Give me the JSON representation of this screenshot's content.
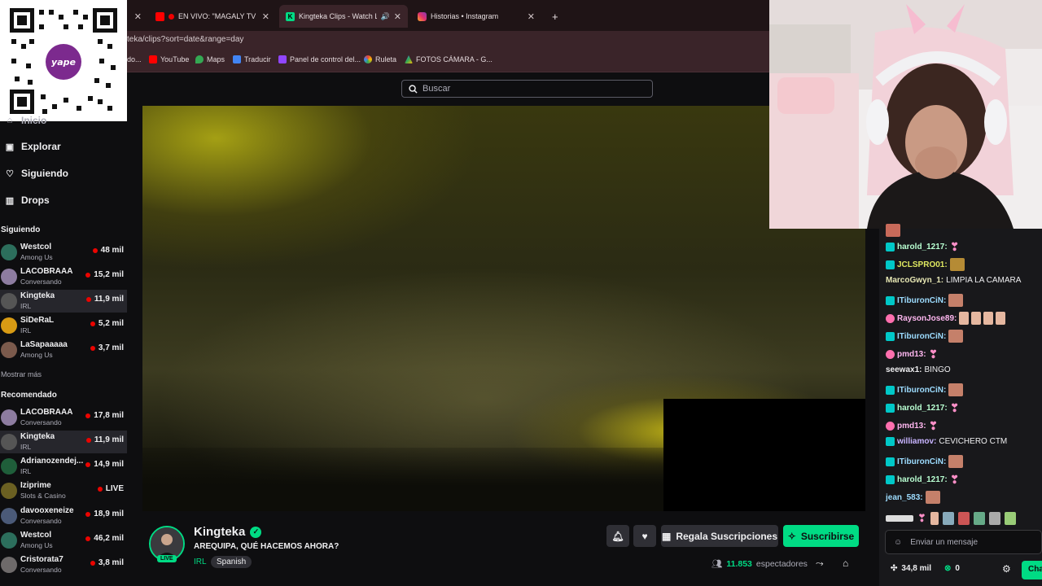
{
  "browser": {
    "tabs": [
      {
        "label": "EN VIVO: \"MAGALY TV LA FI",
        "icon": "youtube-icon"
      },
      {
        "label": "Kingteka Clips - Watch Live",
        "icon": "kick-icon"
      },
      {
        "label": "Historias • Instagram",
        "icon": "instagram-icon"
      }
    ],
    "url": "teka/clips?sort=date&range=day",
    "bookmarks": [
      "YouTube",
      "Maps",
      "Traducir",
      "Panel de control del...",
      "Ruleta",
      "FOTOS CÁMARA - G..."
    ],
    "bookmark_partial": "do..."
  },
  "search": {
    "placeholder": "Buscar"
  },
  "nav": {
    "partial": "Inicio",
    "items": [
      "Explorar",
      "Siguiendo",
      "Drops"
    ]
  },
  "following": {
    "title": "Siguiendo",
    "channels": [
      {
        "name": "Westcol",
        "game": "Among Us",
        "viewers": "48 mil"
      },
      {
        "name": "LACOBRAAA",
        "game": "Conversando",
        "viewers": "15,2 mil"
      },
      {
        "name": "Kingteka",
        "game": "IRL",
        "viewers": "11,9 mil"
      },
      {
        "name": "SiDeRaL",
        "game": "IRL",
        "viewers": "5,2 mil"
      },
      {
        "name": "LaSapaaaaa",
        "game": "Among Us",
        "viewers": "3,7 mil"
      }
    ],
    "more": "Mostrar más"
  },
  "recommended": {
    "title": "Recomendado",
    "channels": [
      {
        "name": "LACOBRAAA",
        "game": "Conversando",
        "viewers": "17,8 mil"
      },
      {
        "name": "Kingteka",
        "game": "IRL",
        "viewers": "11,9 mil"
      },
      {
        "name": "Adrianozendej...",
        "game": "IRL",
        "viewers": "14,9 mil"
      },
      {
        "name": "Iziprime",
        "game": "Slots & Casino",
        "viewers": "LIVE"
      },
      {
        "name": "davooxeneize",
        "game": "Conversando",
        "viewers": "18,9 mil"
      },
      {
        "name": "Westcol",
        "game": "Among Us",
        "viewers": "46,2 mil"
      },
      {
        "name": "Cristorata7",
        "game": "Conversando",
        "viewers": "3,8 mil"
      }
    ]
  },
  "stream": {
    "channel": "Kingteka",
    "title": "AREQUIPA, QUÉ HACEMOS AHORA?",
    "category": "IRL",
    "tag": "Spanish",
    "live_badge": "LIVE",
    "viewer_count": "11.853",
    "viewer_label": "espectadores",
    "gift_label": "Regala Suscripciones",
    "subscribe_label": "Suscribirse"
  },
  "chat": {
    "messages": [
      {
        "user": "harold_1217:",
        "text": "",
        "color": "#b9ffd2",
        "badge": true
      },
      {
        "user": "JCLSPRO01:",
        "text": "",
        "color": "#dfe860",
        "badge": true
      },
      {
        "user": "MarcoGwyn_1:",
        "text": "LIMPIA LA CAMARA",
        "color": "#e7e7b4",
        "badge": false
      },
      {
        "user": "ITiburonCiN:",
        "text": "",
        "color": "#9ddcff",
        "badge": true
      },
      {
        "user": "RaysonJose89:",
        "text": "",
        "color": "#ffb7f0",
        "badge": true
      },
      {
        "user": "ITiburonCiN:",
        "text": "",
        "color": "#9ddcff",
        "badge": true
      },
      {
        "user": "pmd13:",
        "text": "",
        "color": "#ffb7f0",
        "badge": true
      },
      {
        "user": "seewax1:",
        "text": "BINGO",
        "color": "#efeff1",
        "badge": false
      },
      {
        "user": "ITiburonCiN:",
        "text": "",
        "color": "#9ddcff",
        "badge": true
      },
      {
        "user": "harold_1217:",
        "text": "",
        "color": "#b9ffd2",
        "badge": true
      },
      {
        "user": "pmd13:",
        "text": "",
        "color": "#ffb7f0",
        "badge": true
      },
      {
        "user": "williamov:",
        "text": "CEVICHERO CTM",
        "color": "#c8b4ff",
        "badge": true
      },
      {
        "user": "ITiburonCiN:",
        "text": "",
        "color": "#9ddcff",
        "badge": true
      },
      {
        "user": "harold_1217:",
        "text": "",
        "color": "#b9ffd2",
        "badge": true
      },
      {
        "user": "jean_583:",
        "text": "",
        "color": "#9ddcff",
        "badge": false
      }
    ],
    "input_placeholder": "Enviar un mensaje",
    "points": "34,8 mil",
    "count": "0",
    "chat_button": "Cha"
  },
  "colors": {
    "accent": "#00db84",
    "live": "#eb0400"
  }
}
